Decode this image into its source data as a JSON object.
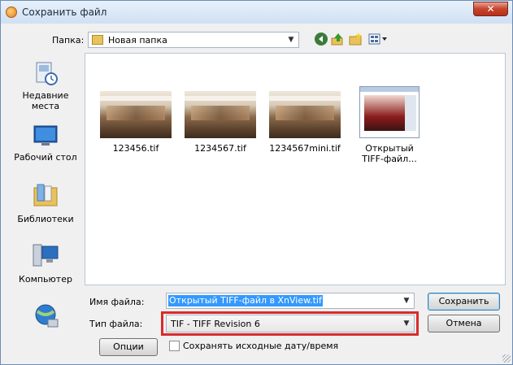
{
  "window": {
    "title": "Сохранить файл",
    "close_glyph": "✕"
  },
  "folder": {
    "label": "Папка:",
    "current": "Новая папка"
  },
  "places": [
    {
      "label_line1": "Недавние",
      "label_line2": "места",
      "icon": "recent-places-icon"
    },
    {
      "label_line1": "Рабочий стол",
      "label_line2": "",
      "icon": "desktop-icon"
    },
    {
      "label_line1": "Библиотеки",
      "label_line2": "",
      "icon": "libraries-icon"
    },
    {
      "label_line1": "Компьютер",
      "label_line2": "",
      "icon": "computer-icon"
    },
    {
      "label_line1": "",
      "label_line2": "",
      "icon": "network-icon"
    }
  ],
  "files": [
    {
      "name": "123456.tif",
      "name2": ""
    },
    {
      "name": "1234567.tif",
      "name2": ""
    },
    {
      "name": "1234567mini.tif",
      "name2": ""
    },
    {
      "name": "Открытый",
      "name2": "TIFF-файл..."
    }
  ],
  "filename": {
    "label": "Имя файла:",
    "value": "Открытый TIFF-файл в XnView.tif"
  },
  "filetype": {
    "label": "Тип файла:",
    "value": "TIF - TIFF Revision 6"
  },
  "buttons": {
    "save": "Сохранить",
    "cancel": "Отмена",
    "options": "Опции"
  },
  "preserve_date": {
    "label": "Сохранять исходные дату/время",
    "checked": false
  },
  "highlight_color": "#d92b2b"
}
